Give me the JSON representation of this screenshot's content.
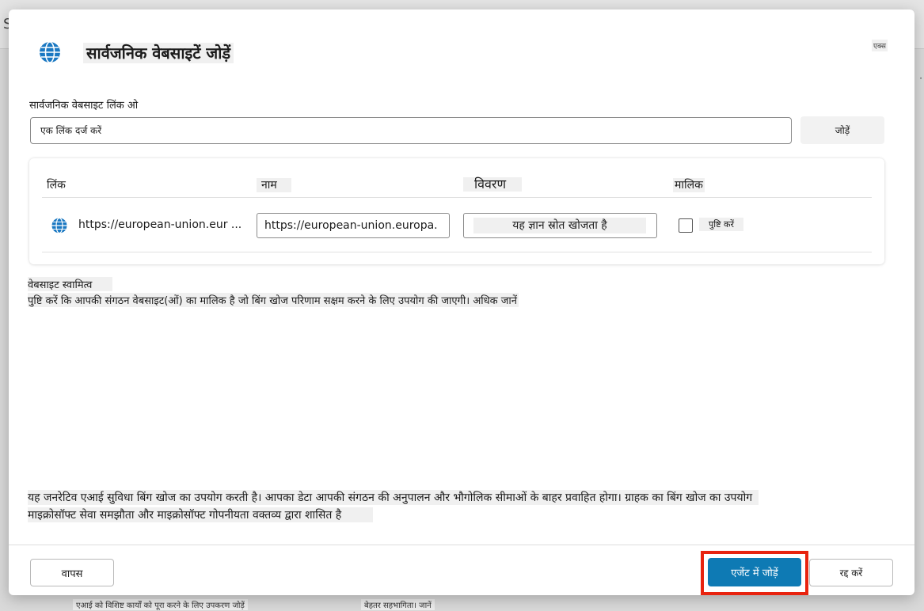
{
  "background": {
    "first_letter": "S",
    "footer_left": "एआई को विशिष्ट कार्यों को पूरा करने के लिए उपकरण जोड़ें",
    "footer_right": "बेहतर सहभागिता। जानें"
  },
  "dialog": {
    "title": "सार्वजनिक वेबसाइटें जोड़ें",
    "close_label": "एक्स",
    "link_section_label": "सार्वजनिक वेबसाइट लिंक ओ",
    "link_input_placeholder": "एक लिंक दर्ज करें",
    "add_button": "जोड़ें",
    "table": {
      "headers": {
        "link": "लिंक",
        "name": "नाम",
        "description": "विवरण",
        "owner": "मालिक"
      },
      "rows": [
        {
          "url": "https://european-union.eur ...",
          "name": "https://european-union.europa.",
          "description": "यह ज्ञान स्रोत खोजता है",
          "owner_checkbox_label": "पुष्टि करें",
          "owner_checked": false
        }
      ]
    },
    "ownership": {
      "title": "वेबसाइट स्वामित्व",
      "description": "पुष्टि करें कि आपकी संगठन वेबसाइट(ओं) का मालिक है जो बिंग खोज परिणाम सक्षम करने के लिए उपयोग की जाएगी।",
      "learn_more": "अधिक जानें"
    },
    "disclaimer_line_1": "यह जनरेटिव एआई सुविधा बिंग खोज का उपयोग करती है। आपका डेटा आपकी संगठन की अनुपालन और भौगोलिक सीमाओं के बाहर प्रवाहित होगा। ग्राहक का बिंग खोज का उपयोग",
    "disclaimer_line_2": "माइक्रोसॉफ्ट सेवा समझौता और माइक्रोसॉफ्ट गोपनीयता वक्तव्य द्वारा शासित है",
    "buttons": {
      "back": "वापस",
      "add_to_agent": "एजेंट में जोड़ें",
      "cancel": "रद्द करें"
    },
    "colors": {
      "primary": "#0e7ab4",
      "highlight": "#e8230f"
    }
  }
}
